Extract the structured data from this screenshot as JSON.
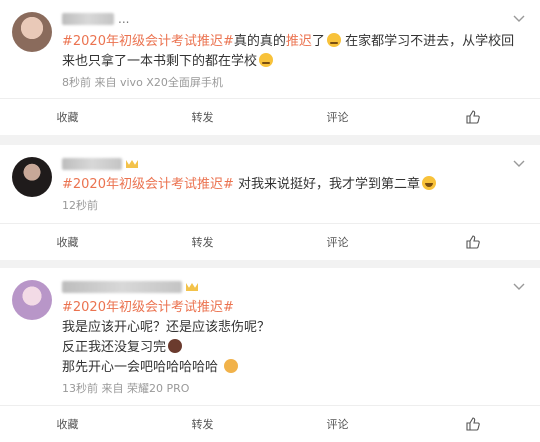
{
  "posts": [
    {
      "username_tail": "...",
      "hashtag": "#2020年初级会计考试推迟#",
      "text_a": "真的真的",
      "highlight": "推迟",
      "text_b": "了",
      "text_c": "在家都学习不进去，从学校回来也只拿了一本书剩下的都在学校",
      "meta": "8秒前   来自 vivo X20全面屏手机",
      "actions": {
        "collect": "收藏",
        "repost": "转发",
        "comment": "评论"
      }
    },
    {
      "username": "凌巧眼七单",
      "hashtag": "#2020年初级会计考试推迟#",
      "text_a": "对我来说挺好，我才学到第二章",
      "meta": "12秒前",
      "actions": {
        "collect": "收藏",
        "repost": "转发",
        "comment": "评论"
      }
    },
    {
      "username": "有趣的灵魂万里挑一作的内双理儿",
      "hashtag": "#2020年初级会计考试推迟#",
      "line2": "我是应该开心呢？还是应该悲伤呢？",
      "line3": "反正我还没复习完",
      "line4": "那先开心一会吧哈哈哈哈哈",
      "meta": "13秒前   来自 荣耀20 PRO",
      "actions": {
        "collect": "收藏",
        "repost": "转发",
        "comment": "评论"
      }
    }
  ],
  "colors": {
    "hashtag": "#eb7350",
    "meta": "#999999"
  }
}
